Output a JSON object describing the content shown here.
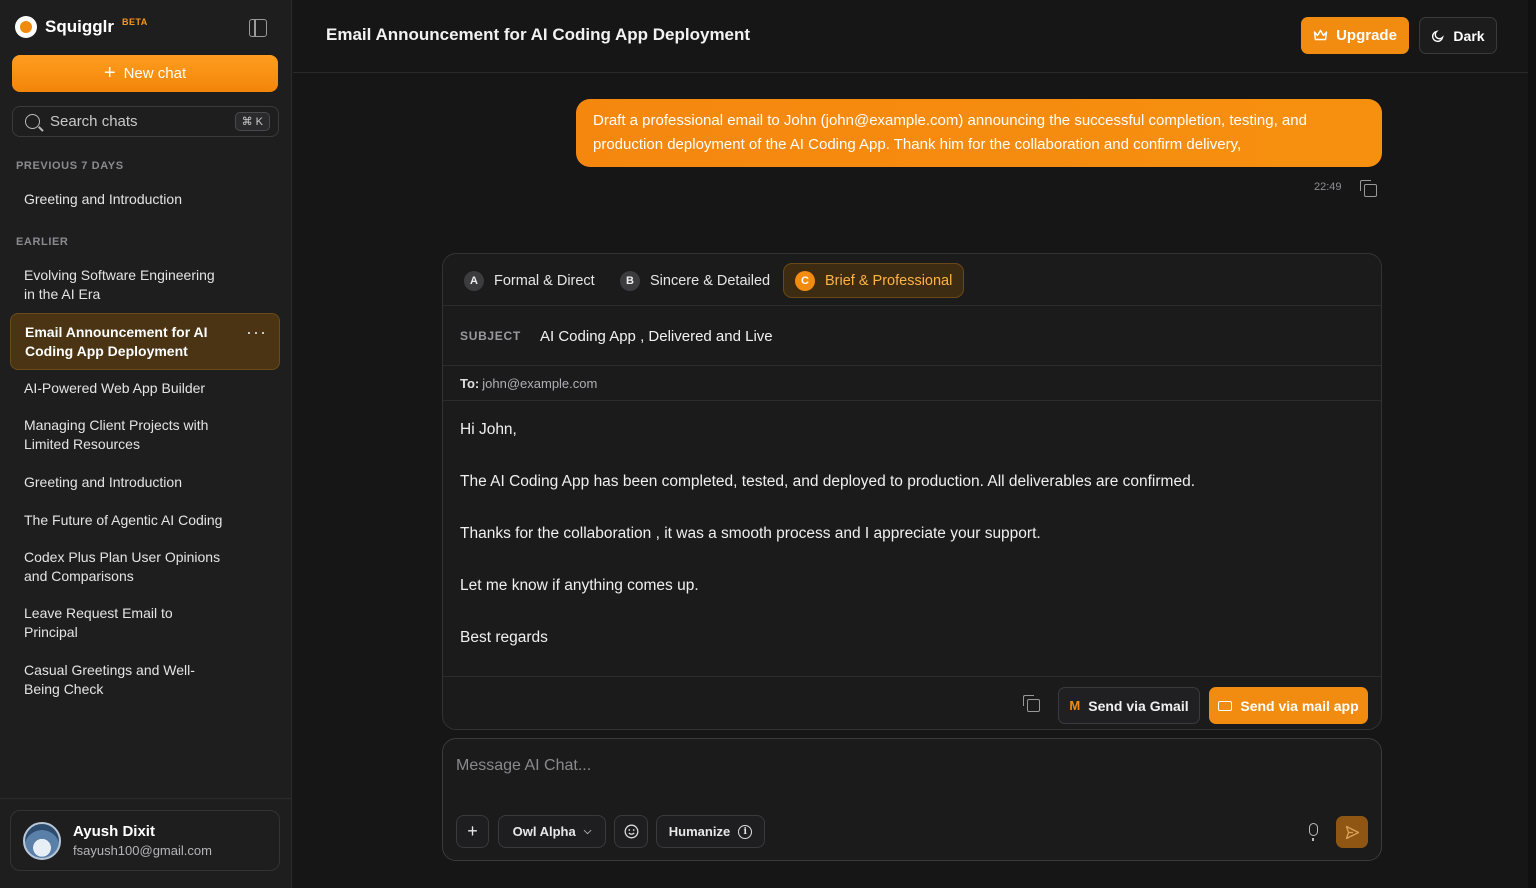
{
  "app": {
    "name": "Squigglr",
    "badge": "BETA"
  },
  "sidebar": {
    "new_chat_label": "New chat",
    "search": {
      "placeholder": "Search chats",
      "shortcut": "⌘ K"
    },
    "sections": [
      {
        "label": "PREVIOUS 7 DAYS",
        "items": [
          "Greeting and Introduction"
        ]
      },
      {
        "label": "EARLIER",
        "items": [
          "Evolving Software Engineering in the AI Era",
          "Email Announcement for AI Coding App Deployment",
          "AI-Powered Web App Builder",
          "Managing Client Projects with Limited Resources",
          "Greeting and Introduction",
          "The Future of Agentic AI Coding",
          "Codex Plus Plan User Opinions and Comparisons",
          "Leave Request Email to Principal",
          "Casual Greetings and Well-Being Check"
        ]
      }
    ],
    "active_item": "Email Announcement for AI Coding App Deployment",
    "user": {
      "name": "Ayush Dixit",
      "email": "fsayush100@gmail.com"
    }
  },
  "header": {
    "title": "Email Announcement for AI Coding App Deployment",
    "upgrade_label": "Upgrade",
    "theme_label": "Dark"
  },
  "conversation": {
    "user_message": "Draft a professional email to John (john@example.com) announcing the successful completion, testing, and production deployment of the AI Coding App. Thank him for the collaboration and confirm delivery,",
    "user_message_time": "22:49"
  },
  "email_card": {
    "tabs": [
      {
        "key": "A",
        "label": "Formal & Direct"
      },
      {
        "key": "B",
        "label": "Sincere & Detailed"
      },
      {
        "key": "C",
        "label": "Brief & Professional",
        "active": true
      }
    ],
    "subject_label": "SUBJECT",
    "subject": "AI Coding App , Delivered and Live",
    "to_label": "To:",
    "to": "john@example.com",
    "body": [
      "Hi John,",
      "The AI Coding App has been completed, tested, and deployed to production. All deliverables are confirmed.",
      "Thanks for the collaboration , it was a smooth process and I appreciate your support.",
      "Let me know if anything comes up.",
      "Best regards"
    ],
    "send_gmail_label": "Send via Gmail",
    "send_mailapp_label": "Send via mail app"
  },
  "composer": {
    "placeholder": "Message AI Chat...",
    "model": "Owl Alpha",
    "humanize_label": "Humanize"
  },
  "colors": {
    "accent": "#f28c10",
    "background": "#161616",
    "sidebar": "#1e1e1f"
  }
}
